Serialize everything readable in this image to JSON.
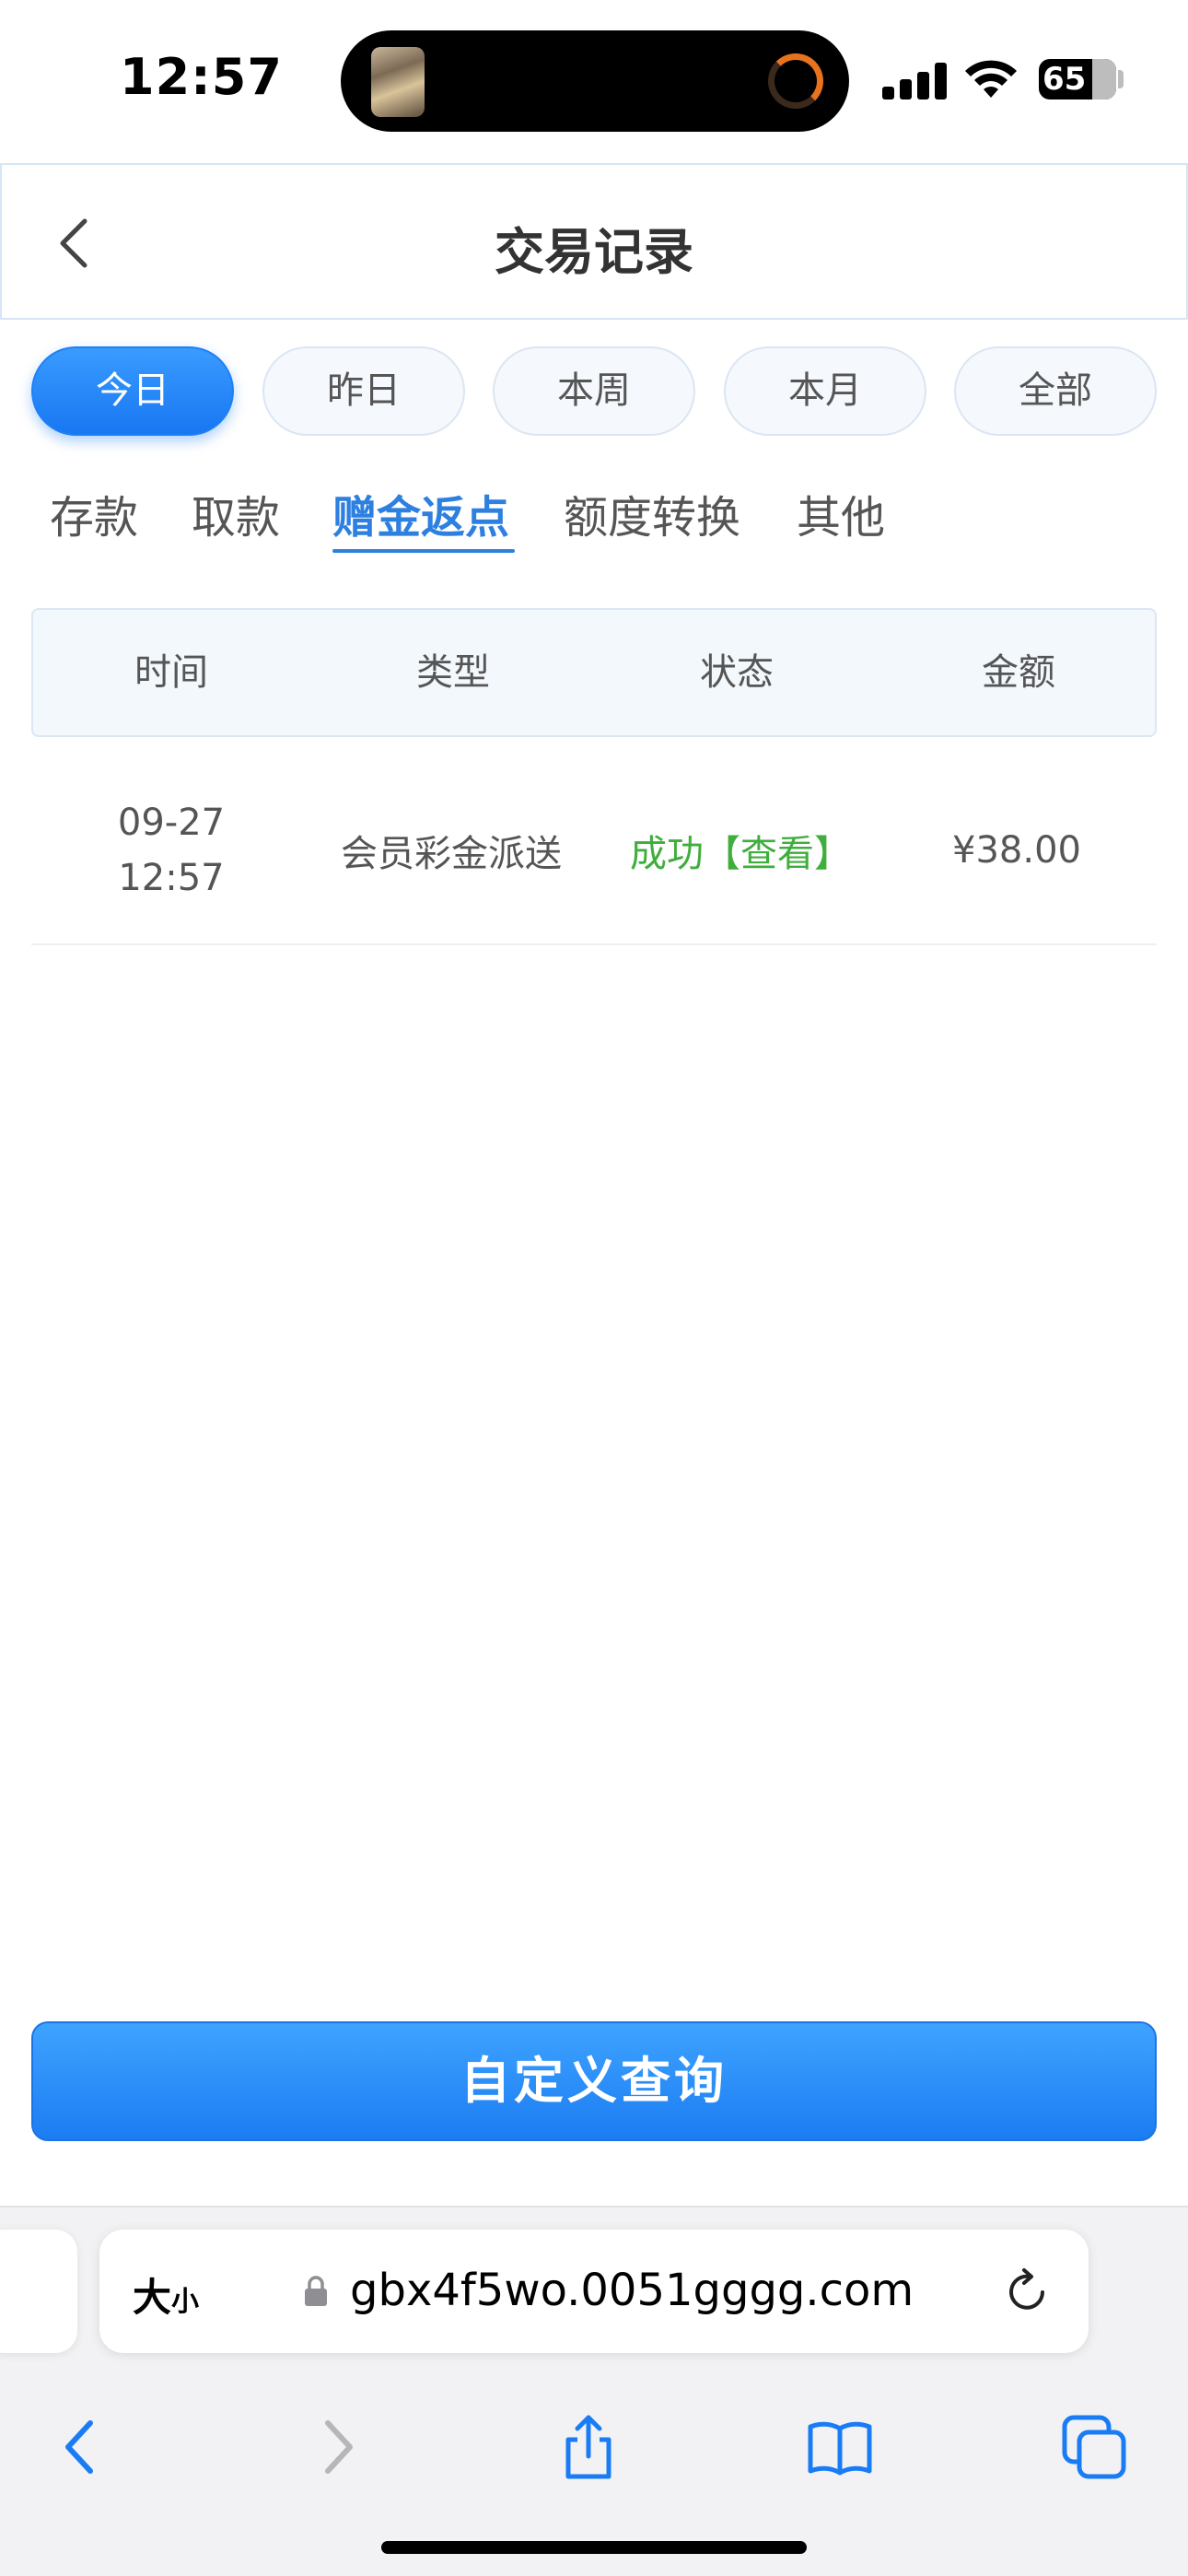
{
  "status_bar": {
    "time": "12:57",
    "battery": "65"
  },
  "header": {
    "title": "交易记录"
  },
  "date_filters": [
    {
      "label": "今日",
      "active": true
    },
    {
      "label": "昨日",
      "active": false
    },
    {
      "label": "本周",
      "active": false
    },
    {
      "label": "本月",
      "active": false
    },
    {
      "label": "全部",
      "active": false
    }
  ],
  "category_tabs": [
    {
      "label": "存款",
      "active": false
    },
    {
      "label": "取款",
      "active": false
    },
    {
      "label": "赠金返点",
      "active": true
    },
    {
      "label": "额度转换",
      "active": false
    },
    {
      "label": "其他",
      "active": false
    }
  ],
  "table": {
    "columns": [
      "时间",
      "类型",
      "状态",
      "金额"
    ],
    "rows": [
      {
        "date": "09-27",
        "time": "12:57",
        "type": "会员彩金派送",
        "status": "成功",
        "view": "【查看】",
        "amount": "¥38.00"
      }
    ]
  },
  "query_button": {
    "label": "自定义查询"
  },
  "browser": {
    "text_size_label": "大",
    "text_size_small": "小",
    "url": "gbx4f5wo.0051gggg.com"
  },
  "colors": {
    "accent": "#1877f2",
    "success": "#3fae3c",
    "active_tab": "#2d7fe0"
  }
}
